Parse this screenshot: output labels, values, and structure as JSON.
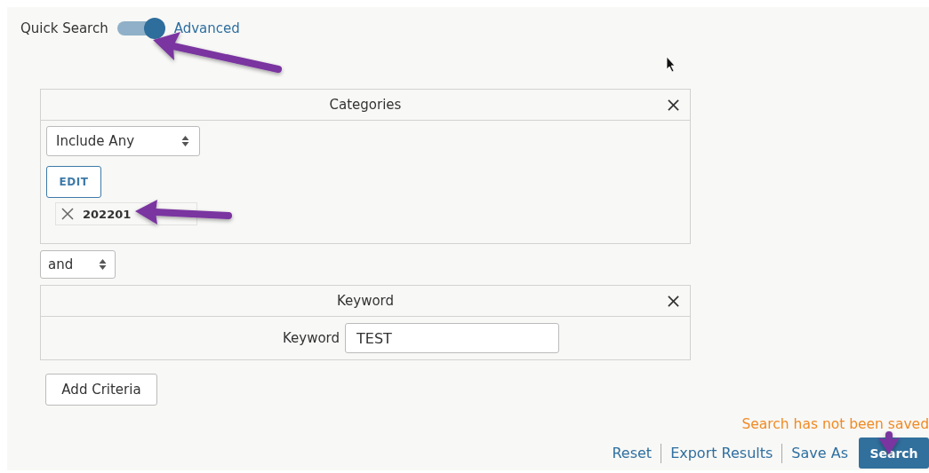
{
  "toggle": {
    "off_label": "Quick Search",
    "on_label": "Advanced",
    "on": true
  },
  "criteria": [
    {
      "kind": "categories",
      "title": "Categories",
      "mode": "Include Any",
      "edit_label": "EDIT",
      "tags": [
        "202201"
      ]
    },
    {
      "kind": "connector",
      "value": "and"
    },
    {
      "kind": "keyword",
      "title": "Keyword",
      "field_label": "Keyword",
      "value": "TEST"
    }
  ],
  "add_button": "Add Criteria",
  "status_message": "Search has not been saved",
  "links": [
    "Reset",
    "Export Results",
    "Save As"
  ],
  "search_button": "Search"
}
